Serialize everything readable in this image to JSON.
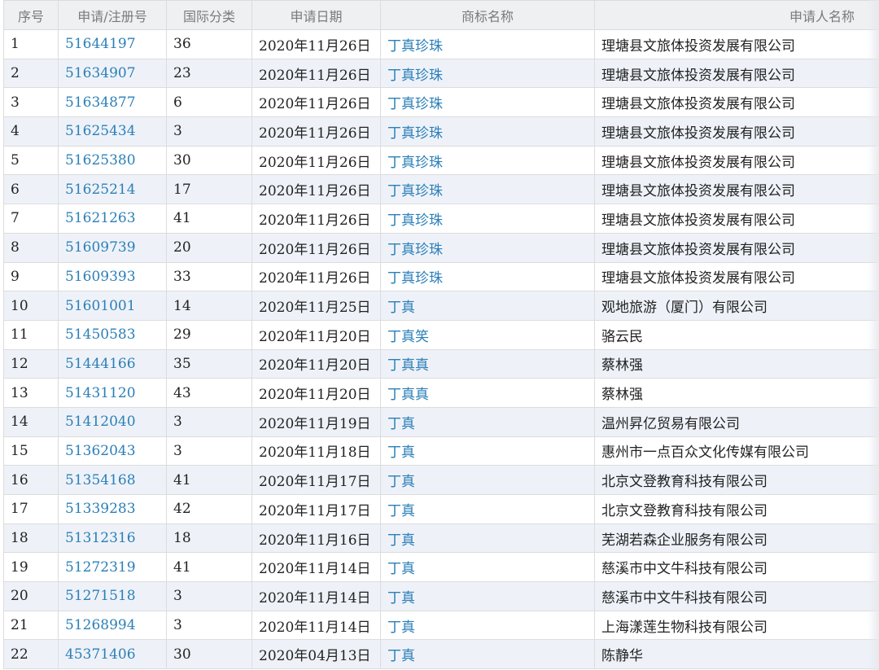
{
  "columns": {
    "index": "序号",
    "reg_no": "申请/注册号",
    "intl_class": "国际分类",
    "apply_date": "申请日期",
    "trademark_name": "商标名称",
    "applicant": "申请人名称"
  },
  "rows": [
    {
      "index": "1",
      "reg_no": "51644197",
      "intl_class": "36",
      "apply_date": "2020年11月26日",
      "trademark_name": "丁真珍珠",
      "applicant": "理塘县文旅体投资发展有限公司"
    },
    {
      "index": "2",
      "reg_no": "51634907",
      "intl_class": "23",
      "apply_date": "2020年11月26日",
      "trademark_name": "丁真珍珠",
      "applicant": "理塘县文旅体投资发展有限公司"
    },
    {
      "index": "3",
      "reg_no": "51634877",
      "intl_class": "6",
      "apply_date": "2020年11月26日",
      "trademark_name": "丁真珍珠",
      "applicant": "理塘县文旅体投资发展有限公司"
    },
    {
      "index": "4",
      "reg_no": "51625434",
      "intl_class": "3",
      "apply_date": "2020年11月26日",
      "trademark_name": "丁真珍珠",
      "applicant": "理塘县文旅体投资发展有限公司"
    },
    {
      "index": "5",
      "reg_no": "51625380",
      "intl_class": "30",
      "apply_date": "2020年11月26日",
      "trademark_name": "丁真珍珠",
      "applicant": "理塘县文旅体投资发展有限公司"
    },
    {
      "index": "6",
      "reg_no": "51625214",
      "intl_class": "17",
      "apply_date": "2020年11月26日",
      "trademark_name": "丁真珍珠",
      "applicant": "理塘县文旅体投资发展有限公司"
    },
    {
      "index": "7",
      "reg_no": "51621263",
      "intl_class": "41",
      "apply_date": "2020年11月26日",
      "trademark_name": "丁真珍珠",
      "applicant": "理塘县文旅体投资发展有限公司"
    },
    {
      "index": "8",
      "reg_no": "51609739",
      "intl_class": "20",
      "apply_date": "2020年11月26日",
      "trademark_name": "丁真珍珠",
      "applicant": "理塘县文旅体投资发展有限公司"
    },
    {
      "index": "9",
      "reg_no": "51609393",
      "intl_class": "33",
      "apply_date": "2020年11月26日",
      "trademark_name": "丁真珍珠",
      "applicant": "理塘县文旅体投资发展有限公司"
    },
    {
      "index": "10",
      "reg_no": "51601001",
      "intl_class": "14",
      "apply_date": "2020年11月25日",
      "trademark_name": "丁真",
      "applicant": "观地旅游（厦门）有限公司"
    },
    {
      "index": "11",
      "reg_no": "51450583",
      "intl_class": "29",
      "apply_date": "2020年11月20日",
      "trademark_name": "丁真笑",
      "applicant": "骆云民"
    },
    {
      "index": "12",
      "reg_no": "51444166",
      "intl_class": "35",
      "apply_date": "2020年11月20日",
      "trademark_name": "丁真真",
      "applicant": "蔡林强"
    },
    {
      "index": "13",
      "reg_no": "51431120",
      "intl_class": "43",
      "apply_date": "2020年11月20日",
      "trademark_name": "丁真真",
      "applicant": "蔡林强"
    },
    {
      "index": "14",
      "reg_no": "51412040",
      "intl_class": "3",
      "apply_date": "2020年11月19日",
      "trademark_name": "丁真",
      "applicant": "温州昇亿贸易有限公司"
    },
    {
      "index": "15",
      "reg_no": "51362043",
      "intl_class": "3",
      "apply_date": "2020年11月18日",
      "trademark_name": "丁真",
      "applicant": "惠州市一点百众文化传媒有限公司"
    },
    {
      "index": "16",
      "reg_no": "51354168",
      "intl_class": "41",
      "apply_date": "2020年11月17日",
      "trademark_name": "丁真",
      "applicant": "北京文登教育科技有限公司"
    },
    {
      "index": "17",
      "reg_no": "51339283",
      "intl_class": "42",
      "apply_date": "2020年11月17日",
      "trademark_name": "丁真",
      "applicant": "北京文登教育科技有限公司"
    },
    {
      "index": "18",
      "reg_no": "51312316",
      "intl_class": "18",
      "apply_date": "2020年11月16日",
      "trademark_name": "丁真",
      "applicant": "芜湖若森企业服务有限公司"
    },
    {
      "index": "19",
      "reg_no": "51272319",
      "intl_class": "41",
      "apply_date": "2020年11月14日",
      "trademark_name": "丁真",
      "applicant": "慈溪市中文牛科技有限公司"
    },
    {
      "index": "20",
      "reg_no": "51271518",
      "intl_class": "3",
      "apply_date": "2020年11月14日",
      "trademark_name": "丁真",
      "applicant": "慈溪市中文牛科技有限公司"
    },
    {
      "index": "21",
      "reg_no": "51268994",
      "intl_class": "3",
      "apply_date": "2020年11月14日",
      "trademark_name": "丁真",
      "applicant": "上海漾莲生物科技有限公司"
    },
    {
      "index": "22",
      "reg_no": "45371406",
      "intl_class": "30",
      "apply_date": "2020年04月13日",
      "trademark_name": "丁真",
      "applicant": "陈静华"
    }
  ]
}
